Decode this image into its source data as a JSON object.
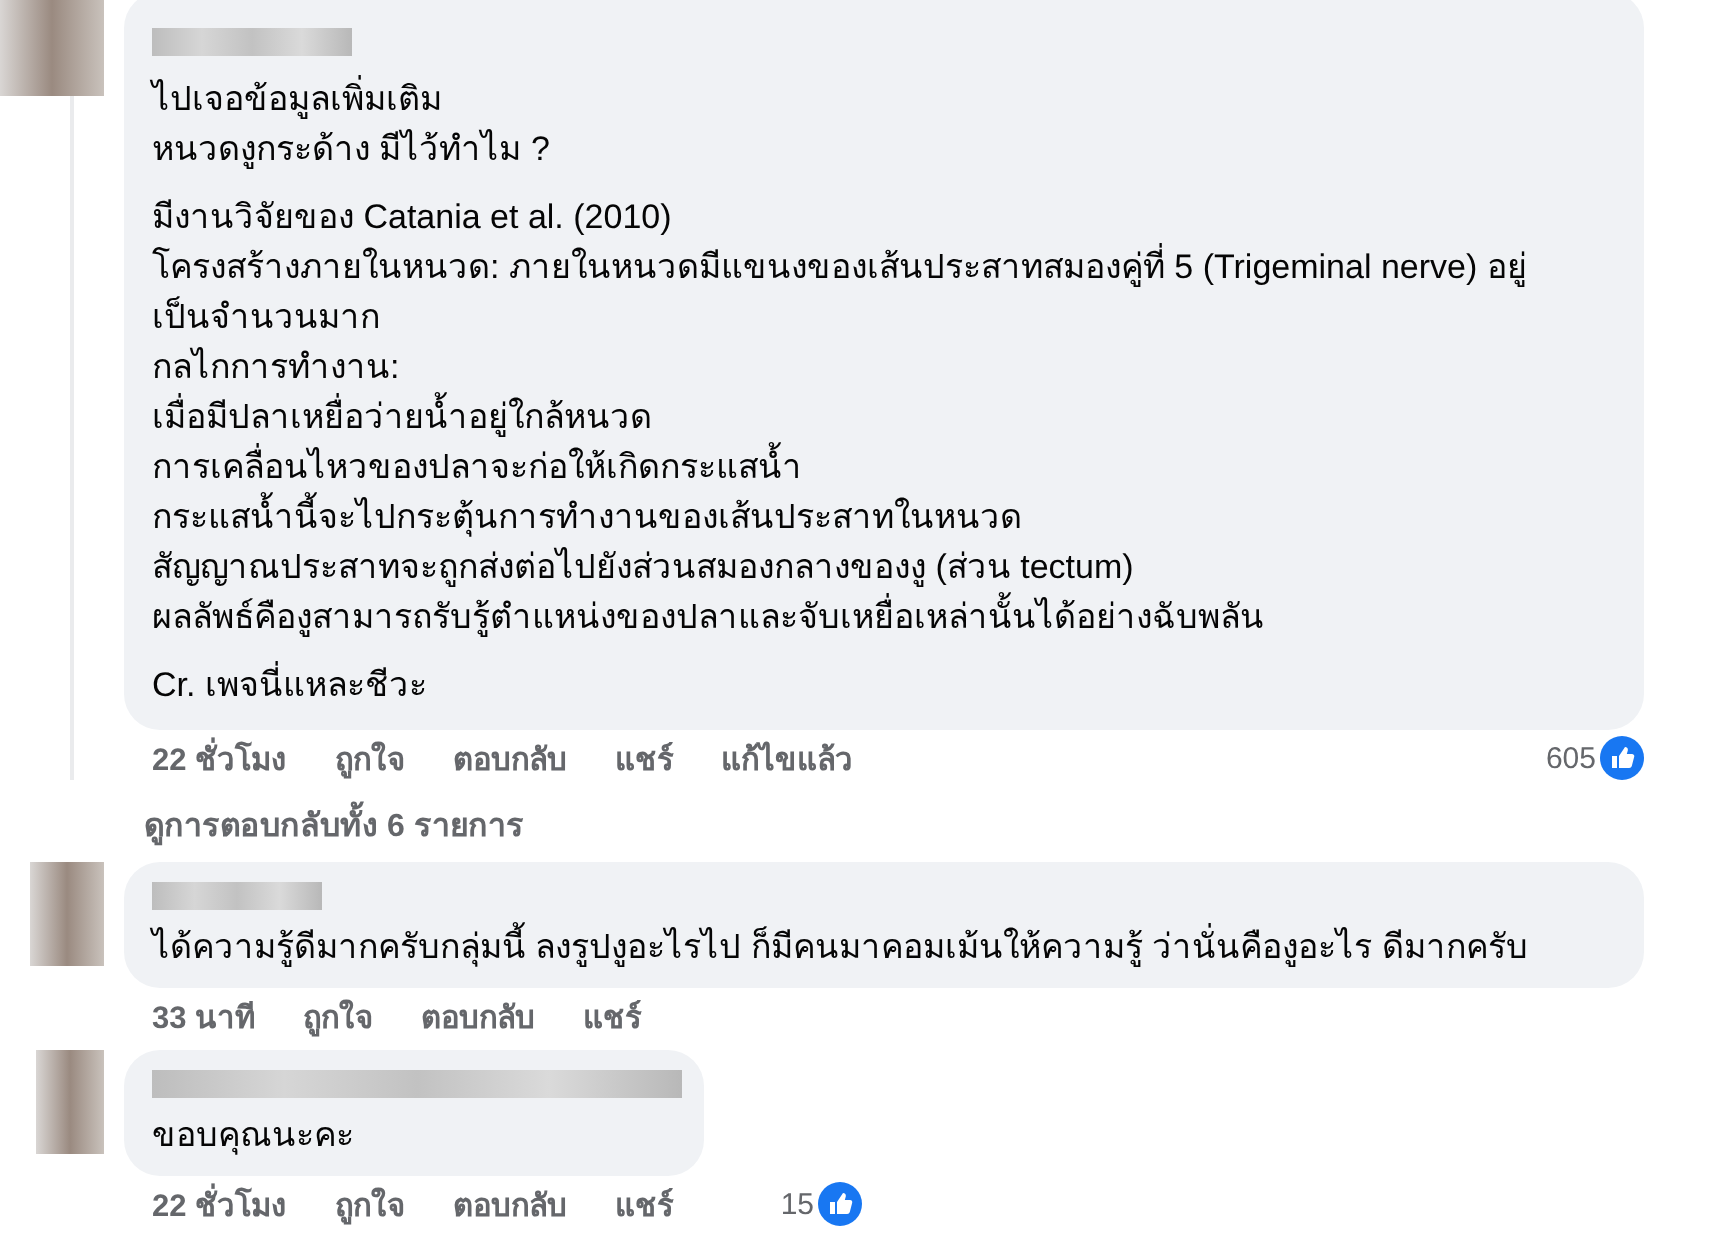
{
  "comments": [
    {
      "body": [
        [
          "ไปเจอข้อมูลเพิ่มเติม",
          "หนวดงูกระด้าง มีไว้ทำไม ?"
        ],
        [
          "มีงานวิจัยของ Catania et al. (2010)",
          "โครงสร้างภายในหนวด: ภายในหนวดมีแขนงของเส้นประสาทสมองคู่ที่ 5 (Trigeminal nerve) อยู่เป็นจำนวนมาก",
          "กลไกการทำงาน:",
          "เมื่อมีปลาเหยื่อว่ายน้ำอยู่ใกล้หนวด",
          "การเคลื่อนไหวของปลาจะก่อให้เกิดกระแสน้ำ",
          "กระแสน้ำนี้จะไปกระตุ้นการทำงานของเส้นประสาทในหนวด",
          "สัญญาณประสาทจะถูกส่งต่อไปยังส่วนสมองกลางของงู (ส่วน tectum)",
          "ผลลัพธ์คืองูสามารถรับรู้ตำแหน่งของปลาและจับเหยื่อเหล่านั้นได้อย่างฉับพลัน"
        ],
        [
          "Cr. เพจนี่แหละชีวะ"
        ]
      ],
      "time": "22 ชั่วโมง",
      "actions": [
        "ถูกใจ",
        "ตอบกลับ",
        "แชร์"
      ],
      "edited": "แก้ไขแล้ว",
      "reactions": "605",
      "view_replies": "ดูการตอบกลับทั้ง 6 รายการ"
    },
    {
      "body": [
        [
          "ได้ความรู้ดีมากครับกลุ่มนี้ ลงรูปงูอะไรไป ก็มีคนมาคอมเม้นให้ความรู้ ว่านั่นคืองูอะไร ดีมากครับ"
        ]
      ],
      "time": "33 นาที",
      "actions": [
        "ถูกใจ",
        "ตอบกลับ",
        "แชร์"
      ]
    },
    {
      "body": [
        [
          "ขอบคุณนะคะ"
        ]
      ],
      "time": "22 ชั่วโมง",
      "actions": [
        "ถูกใจ",
        "ตอบกลับ",
        "แชร์"
      ],
      "reactions": "15"
    }
  ]
}
